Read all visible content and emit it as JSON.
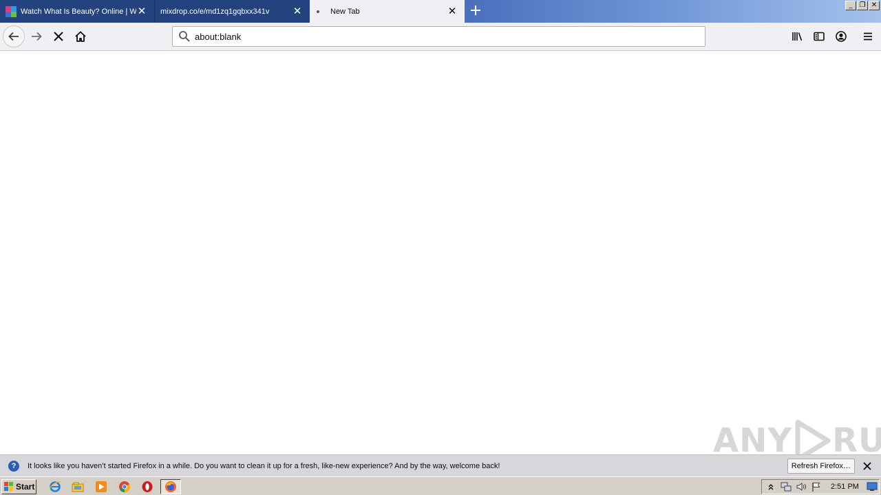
{
  "tabs": [
    {
      "title": "Watch What Is Beauty? Online | W",
      "active": false,
      "icon": "site-favicon"
    },
    {
      "title": "mixdrop.co/e/md1zq1gqbxx341v",
      "active": false,
      "icon": "none"
    },
    {
      "title": "New Tab",
      "active": true,
      "icon": "loading-dot"
    }
  ],
  "window_controls": {
    "minimize": "_",
    "restore": "❐",
    "close": "✕"
  },
  "nav": {
    "back_icon": "back-arrow-icon",
    "forward_icon": "forward-arrow-icon",
    "stop_icon": "stop-icon",
    "home_icon": "home-icon",
    "url": "about:blank",
    "library_icon": "library-icon",
    "sidebar_icon": "sidebar-icon",
    "account_icon": "account-icon",
    "menu_icon": "hamburger-menu-icon"
  },
  "watermark": {
    "left": "ANY",
    "right": "RUN"
  },
  "notification": {
    "icon": "question-icon",
    "text": "It looks like you haven’t started Firefox in a while. Do you want to clean it up for a fresh, like-new experience? And by the way, welcome back!",
    "button": "Refresh Firefox…"
  },
  "taskbar": {
    "start_label": "Start",
    "quick_launch": [
      "internet-explorer-icon",
      "file-explorer-icon",
      "media-player-icon",
      "chrome-icon",
      "opera-icon",
      "firefox-icon"
    ],
    "tray_icons": [
      "show-hidden-icon",
      "network-icon",
      "volume-icon",
      "action-center-flag-icon"
    ],
    "clock": "2:51 PM"
  },
  "colors": {
    "tab_active": "#f0f0f4",
    "tab_inactive": "#24427e",
    "toolbar": "#f0f0f4",
    "notice_bar": "#d7d7db",
    "taskbar": "#d4d0c8"
  }
}
